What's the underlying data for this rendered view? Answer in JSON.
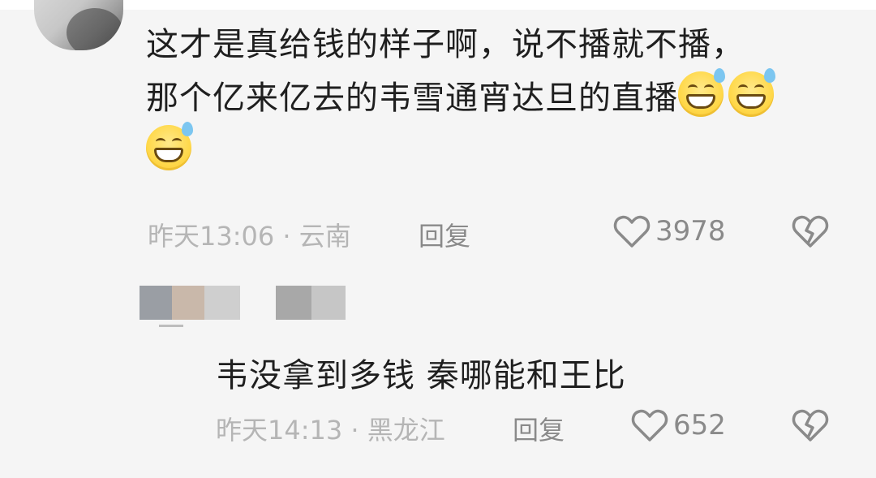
{
  "comments": [
    {
      "text_line1": "这才是真给钱的样子啊，说不播就不播，",
      "text_line2": "那个亿来亿去的韦雪通宵达旦的直播",
      "emojis": [
        "grin-sweat-emoji",
        "grin-sweat-emoji",
        "grin-sweat-emoji"
      ],
      "time_location": "昨天13:06 · 云南",
      "reply_label": "回复",
      "like_count": "3978"
    },
    {
      "text": "韦没拿到多钱 秦哪能和王比",
      "time_location": "昨天14:13 · 黑龙江",
      "reply_label": "回复",
      "like_count": "652"
    }
  ],
  "icons": {
    "like": "heart-outline-icon",
    "dislike": "broken-heart-icon"
  },
  "colors": {
    "background": "#f5f5f5",
    "text": "#1f1f1f",
    "meta": "#b5b5b5",
    "action": "#8a8a8a"
  }
}
